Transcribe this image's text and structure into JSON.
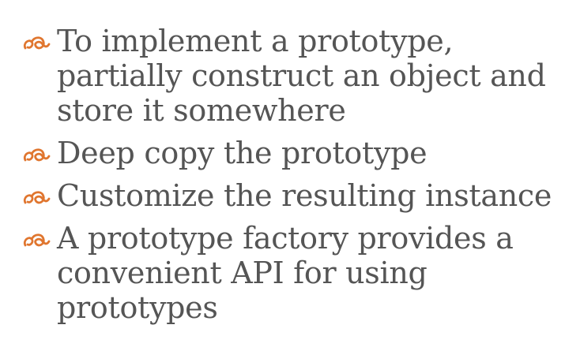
{
  "slide": {
    "bullet_color": "#E0762F",
    "text_color": "#555555",
    "bullets": [
      {
        "text": "To implement a prototype, partially construct an object and store it somewhere",
        "icon": "floral-bullet-icon"
      },
      {
        "text": "Deep copy the prototype",
        "icon": "floral-bullet-icon"
      },
      {
        "text": "Customize the resulting instance",
        "icon": "floral-bullet-icon"
      },
      {
        "text": "A prototype factory provides a convenient API for using prototypes",
        "icon": "floral-bullet-icon"
      }
    ]
  }
}
